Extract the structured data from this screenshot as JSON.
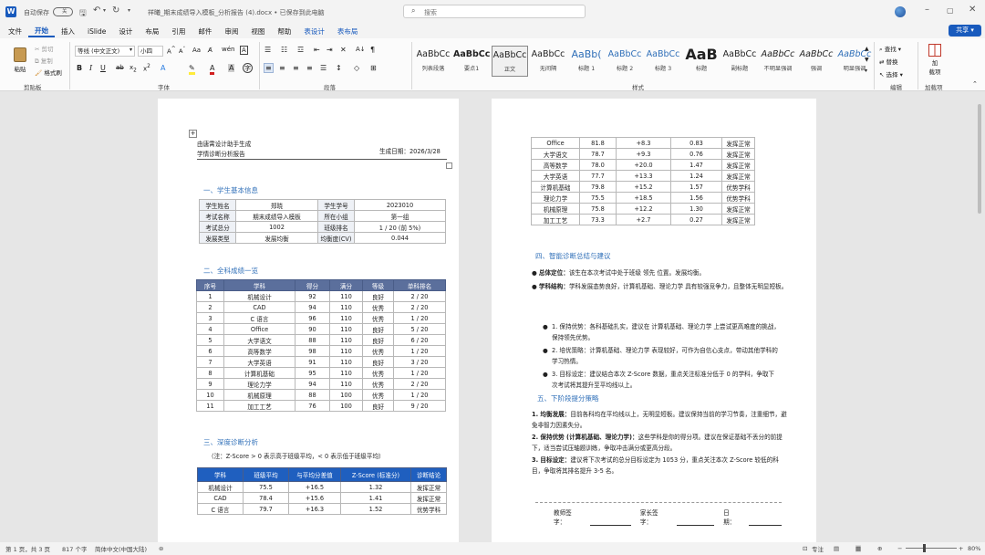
{
  "titlebar": {
    "autosave_label": "自动保存",
    "autosave_state": "关",
    "filename": "祥曦_期末成绩导入模板_分析报告 (4).docx • 已保存到此电脑",
    "search_placeholder": "搜索"
  },
  "ribbon_tabs": [
    "文件",
    "开始",
    "插入",
    "iSlide",
    "设计",
    "布局",
    "引用",
    "邮件",
    "审阅",
    "视图",
    "帮助",
    "表设计",
    "表布局"
  ],
  "share_label": "共享",
  "clipboard": {
    "paste": "粘贴",
    "cut": "剪切",
    "copy": "复制",
    "format_painter": "格式刷",
    "group": "剪贴板"
  },
  "font": {
    "name": "等线 (中文正文)",
    "size": "小四",
    "group": "字体"
  },
  "paragraph": {
    "group": "段落"
  },
  "styles": {
    "group": "样式",
    "items": [
      {
        "preview": "AaBbCc",
        "name": "列表段落"
      },
      {
        "preview": "AaBbCc",
        "name": "要点1"
      },
      {
        "preview": "AaBbCc",
        "name": "正文"
      },
      {
        "preview": "AaBbCc",
        "name": "无间隔"
      },
      {
        "preview": "AaBb(",
        "name": "标题 1"
      },
      {
        "preview": "AaBbCc",
        "name": "标题 2"
      },
      {
        "preview": "AaBbCc",
        "name": "标题 3"
      },
      {
        "preview": "AaB",
        "name": "标题"
      },
      {
        "preview": "AaBbCc",
        "name": "副标题"
      },
      {
        "preview": "AaBbCc",
        "name": "不明显强调"
      },
      {
        "preview": "AaBbCc",
        "name": "强调"
      },
      {
        "preview": "AaBbCc",
        "name": "明显强调"
      }
    ]
  },
  "editing": {
    "find": "查找",
    "replace": "替换",
    "select": "选择",
    "group": "编辑"
  },
  "addins": {
    "label1": "加",
    "label2": "载项",
    "group": "加载项"
  },
  "page1": {
    "header_line1": "由唐霄设计助手生成",
    "header_line2": "学情诊断分析报告",
    "gen_date": "生成日期：2026/3/28",
    "sec1": "一、学生基本信息",
    "info": [
      [
        "学生姓名",
        "郑晓",
        "学生学号",
        "2023010"
      ],
      [
        "考试名称",
        "期末成绩导入模板",
        "所在小组",
        "第一组"
      ],
      [
        "考试总分",
        "1002",
        "班级排名",
        "1 / 20 (前 5%)"
      ],
      [
        "发展类型",
        "发展均衡",
        "均衡度(CV)",
        "0.044"
      ]
    ],
    "sec2": "二、全科成绩一览",
    "grades_head": [
      "序号",
      "学科",
      "得分",
      "满分",
      "等级",
      "单科排名"
    ],
    "grades": [
      [
        "1",
        "机械设计",
        "92",
        "110",
        "良好",
        "2 / 20"
      ],
      [
        "2",
        "CAD",
        "94",
        "110",
        "优秀",
        "2 / 20"
      ],
      [
        "3",
        "C 语言",
        "96",
        "110",
        "优秀",
        "1 / 20"
      ],
      [
        "4",
        "Office",
        "90",
        "110",
        "良好",
        "5 / 20"
      ],
      [
        "5",
        "大学语文",
        "88",
        "110",
        "良好",
        "6 / 20"
      ],
      [
        "6",
        "高等数学",
        "98",
        "110",
        "优秀",
        "1 / 20"
      ],
      [
        "7",
        "大学英语",
        "91",
        "110",
        "良好",
        "3 / 20"
      ],
      [
        "8",
        "计算机基础",
        "95",
        "110",
        "优秀",
        "1 / 20"
      ],
      [
        "9",
        "理论力学",
        "94",
        "110",
        "优秀",
        "2 / 20"
      ],
      [
        "10",
        "机械原理",
        "88",
        "100",
        "优秀",
        "1 / 20"
      ],
      [
        "11",
        "加工工艺",
        "76",
        "100",
        "良好",
        "9 / 20"
      ]
    ],
    "sec3": "三、深度诊断分析",
    "note": "（注：Z-Score > 0 表示高于班级平均，< 0 表示低于班级平均）",
    "z_head": [
      "学科",
      "班级平均",
      "与平均分差值",
      "Z-Score (标准分)",
      "诊断结论"
    ],
    "z_rows": [
      [
        "机械设计",
        "75.5",
        "+16.5",
        "1.32",
        "发挥正常"
      ],
      [
        "CAD",
        "78.4",
        "+15.6",
        "1.41",
        "发挥正常"
      ],
      [
        "C 语言",
        "79.7",
        "+16.3",
        "1.52",
        "优势学科"
      ]
    ]
  },
  "page2": {
    "z_rows": [
      [
        "Office",
        "81.8",
        "+8.3",
        "0.83",
        "发挥正常"
      ],
      [
        "大学语文",
        "78.7",
        "+9.3",
        "0.76",
        "发挥正常"
      ],
      [
        "高等数学",
        "78.0",
        "+20.0",
        "1.47",
        "发挥正常"
      ],
      [
        "大学英语",
        "77.7",
        "+13.3",
        "1.24",
        "发挥正常"
      ],
      [
        "计算机基础",
        "79.8",
        "+15.2",
        "1.57",
        "优势学科"
      ],
      [
        "理论力学",
        "75.5",
        "+18.5",
        "1.56",
        "优势学科"
      ],
      [
        "机械原理",
        "75.8",
        "+12.2",
        "1.30",
        "发挥正常"
      ],
      [
        "加工工艺",
        "73.3",
        "+2.7",
        "0.27",
        "发挥正常"
      ]
    ],
    "sec4": "四、智能诊断总结与建议",
    "b1_label": "总体定位：",
    "b1_text": "该生在本次考试中处于班级 领先 位置。发展均衡。",
    "b2_label": "学科结构：",
    "b2_text": "学科发展态势良好，计算机基础、理论力学 具有较强竞争力，且整体无明显短板。",
    "list": [
      "1. 保持优势：各科基础扎实，建议在 计算机基础、理论力学 上尝试更高难度的挑战，保持领先优势。",
      "2. 培优策略：计算机基础、理论力学 表现较好，可作为自信心支点，带动其他学科的学习热情。",
      "3. 目标设定：建议结合本次 Z-Score 数据，重点关注标准分低于 0 的学科，争取下次考试将其提升至平均线以上。"
    ],
    "sec5": "五、下阶段提分策略",
    "p1_label": "1. 均衡发展：",
    "p1_text": "目前各科均在平均线以上，无明显短板。建议保持当前的学习节奏，注重细节，避免非智力因素失分。",
    "p2_label": "2. 保持优势 (计算机基础、理论力学)：",
    "p2_text": "这些学科是你的得分项。建议在保证基础不丢分的前提下，适当尝试压轴题训练，争取冲击满分或更高分段。",
    "p3_label": "3. 目标设定：",
    "p3_text": "建议将下次考试的总分目标设定为 1053 分，重点关注本次 Z-Score 较低的科目，争取将其排名提升 3-5 名。",
    "sig_teacher": "教师签字：",
    "sig_parent": "家长签字：",
    "sig_date": "日期："
  },
  "status": {
    "page": "第 1 页，共 3 页",
    "words": "817 个字",
    "lang": "简体中文(中国大陆)",
    "focus": "专注",
    "zoom": "80%"
  },
  "colors": {
    "accent": "#185abd",
    "table_head": "#5b6f9c",
    "z_head": "#1f5fbf",
    "heading": "#2f6fb8"
  }
}
